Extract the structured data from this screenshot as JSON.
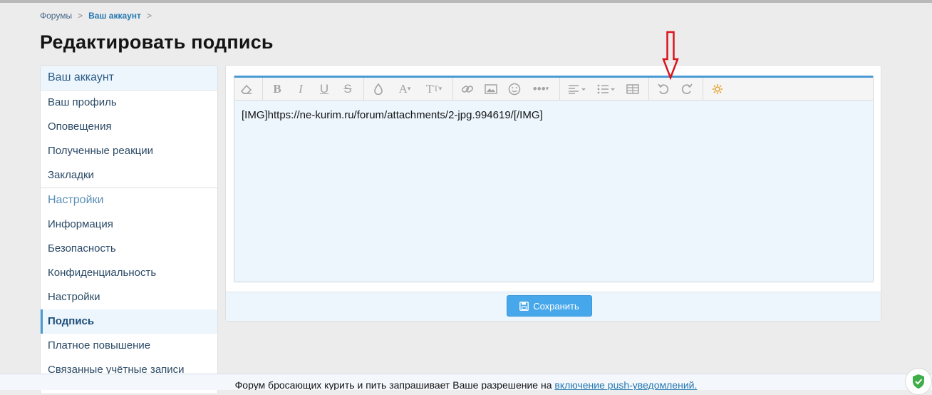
{
  "breadcrumb": {
    "items": [
      "Форумы",
      "Ваш аккаунт"
    ],
    "separator": ">"
  },
  "page": {
    "title": "Редактировать подпись"
  },
  "sidebar": {
    "section1": {
      "title": "Ваш аккаунт",
      "items": [
        "Ваш профиль",
        "Оповещения",
        "Полученные реакции",
        "Закладки"
      ]
    },
    "section2": {
      "title": "Настройки",
      "items": [
        "Информация",
        "Безопасность",
        "Конфиденциальность",
        "Настройки",
        "Подпись",
        "Платное повышение",
        "Связанные учётные записи"
      ]
    },
    "active_item": "Подпись"
  },
  "editor": {
    "toolbar_icons": [
      "eraser-icon",
      "bold-icon",
      "italic-icon",
      "underline-icon",
      "strikethrough-icon",
      "color-icon",
      "font-family-icon",
      "font-size-icon",
      "link-icon",
      "image-icon",
      "smilie-icon",
      "more-icon",
      "align-icon",
      "list-icon",
      "table-icon",
      "undo-icon",
      "redo-icon",
      "bbcode-toggle-icon"
    ],
    "content": "[IMG]https://ne-kurim.ru/forum/attachments/2-jpg.994619/[/IMG]",
    "accent_color": "#4a9ad4",
    "highlight_icon_color": "#e8a83a"
  },
  "save_button": {
    "label": "Сохранить"
  },
  "notice": {
    "text": "Форум бросающих курить и пить запрашивает Ваше разрешение на ",
    "link": "включение push-уведомлений."
  },
  "colors": {
    "button": "#47a7eb",
    "annotation_arrow": "#d9141c"
  }
}
